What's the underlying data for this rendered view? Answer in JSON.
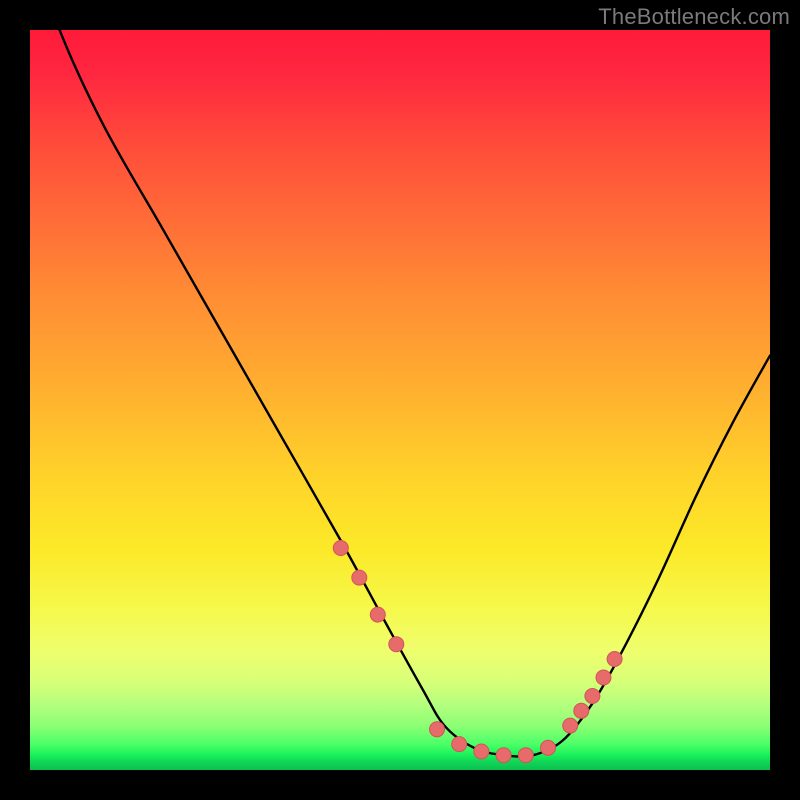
{
  "attribution": "TheBottleneck.com",
  "colors": {
    "frame": "#000000",
    "gradient_top": "#ff1a3a",
    "gradient_bottom": "#0cc051",
    "curve": "#000000",
    "marker_fill": "#e76b6b",
    "marker_stroke": "#d15555"
  },
  "chart_data": {
    "type": "line",
    "title": "",
    "xlabel": "",
    "ylabel": "",
    "xlim": [
      0,
      100
    ],
    "ylim": [
      0,
      100
    ],
    "grid": false,
    "legend": false,
    "series": [
      {
        "name": "bottleneck-curve",
        "x": [
          0,
          4,
          10,
          18,
          26,
          34,
          42,
          48,
          53,
          56,
          60,
          64,
          68,
          72,
          76,
          80,
          85,
          90,
          95,
          100
        ],
        "y": [
          112,
          100,
          87,
          73,
          59,
          45,
          31,
          20,
          11,
          6,
          3,
          2,
          2,
          4,
          9,
          16,
          26,
          37,
          47,
          56
        ]
      }
    ],
    "markers": {
      "name": "highlight-points",
      "x": [
        42,
        44.5,
        47,
        49.5,
        55,
        58,
        61,
        64,
        67,
        70,
        73,
        74.5,
        76,
        77.5,
        79
      ],
      "y": [
        30,
        26,
        21,
        17,
        5.5,
        3.5,
        2.5,
        2,
        2,
        3,
        6,
        8,
        10,
        12.5,
        15
      ]
    }
  }
}
